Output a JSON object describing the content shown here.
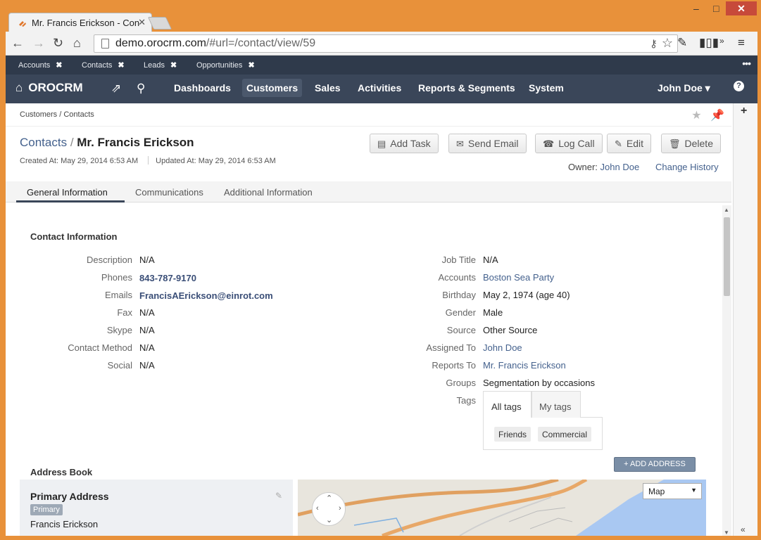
{
  "browser": {
    "tab_title": "Mr. Francis Erickson - Con",
    "url_domain": "demo.orocrm.com",
    "url_path": "/#url=/contact/view/59"
  },
  "pinbar": {
    "items": [
      {
        "label": "Accounts"
      },
      {
        "label": "Contacts"
      },
      {
        "label": "Leads"
      },
      {
        "label": "Opportunities"
      }
    ]
  },
  "nav": {
    "brand": "OROCRM",
    "items": [
      "Dashboards",
      "Customers",
      "Sales",
      "Activities",
      "Reports & Segments",
      "System"
    ],
    "active": "Customers",
    "user": "John Doe",
    "help": "?"
  },
  "page": {
    "breadcrumb": "Customers / Contacts",
    "title_crumb": "Contacts",
    "title_sep": " / ",
    "title_name": "Mr. Francis Erickson",
    "created": "Created At: May 29, 2014 6:53 AM",
    "updated": "Updated At: May 29, 2014 6:53 AM",
    "buttons": {
      "add_task": "Add Task",
      "send_email": "Send Email",
      "log_call": "Log Call",
      "edit": "Edit",
      "delete": "Delete"
    },
    "owner_label": "Owner:",
    "owner_value": "John Doe",
    "change_history": "Change History",
    "tabs": [
      "General Information",
      "Communications",
      "Additional Information"
    ]
  },
  "contact_info": {
    "title": "Contact Information",
    "left": [
      {
        "label": "Description",
        "value": "N/A"
      },
      {
        "label": "Phones",
        "value": "843-787-9170"
      },
      {
        "label": "Emails",
        "value": "FrancisAErickson@einrot.com"
      },
      {
        "label": "Fax",
        "value": "N/A"
      },
      {
        "label": "Skype",
        "value": "N/A"
      },
      {
        "label": "Contact Method",
        "value": "N/A"
      },
      {
        "label": "Social",
        "value": "N/A"
      }
    ],
    "right": [
      {
        "label": "Job Title",
        "value": "N/A"
      },
      {
        "label": "Accounts",
        "value": "Boston Sea Party"
      },
      {
        "label": "Birthday",
        "value": "May 2, 1974 (age 40)"
      },
      {
        "label": "Gender",
        "value": "Male"
      },
      {
        "label": "Source",
        "value": "Other Source"
      },
      {
        "label": "Assigned To",
        "value": "John Doe"
      },
      {
        "label": "Reports To",
        "value": "Mr. Francis Erickson"
      },
      {
        "label": "Groups",
        "value": "Segmentation by occasions"
      },
      {
        "label": "Tags",
        "value": ""
      }
    ],
    "tags": {
      "tabs": [
        "All tags",
        "My tags"
      ],
      "items": [
        "Friends",
        "Commercial"
      ]
    }
  },
  "address_book": {
    "title": "Address Book",
    "add_button": "+ ADD ADDRESS",
    "card_title": "Primary Address",
    "badge": "Primary",
    "name": "Francis Erickson",
    "map_type": "Map"
  },
  "colors": {
    "nav_bg": "#3a4659",
    "pinbar_bg": "#2f3a4b",
    "link": "#44618d",
    "window_frame": "#e8913a"
  }
}
